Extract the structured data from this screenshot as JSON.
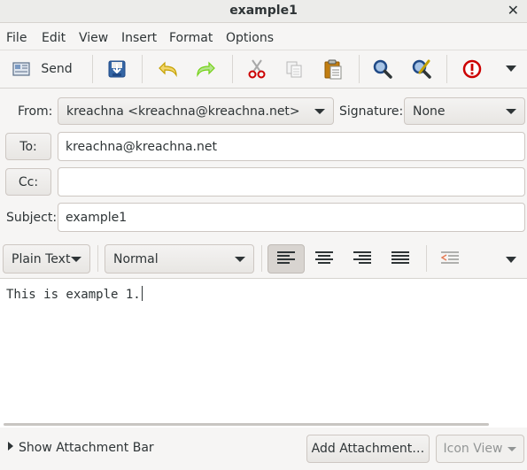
{
  "window": {
    "title": "example1"
  },
  "menubar": {
    "items": [
      "File",
      "Edit",
      "View",
      "Insert",
      "Format",
      "Options"
    ]
  },
  "toolbar": {
    "send_label": "Send",
    "icons": [
      "send-icon",
      "save-draft-icon",
      "undo-icon",
      "redo-icon",
      "cut-icon",
      "copy-icon",
      "paste-icon",
      "find-icon",
      "spell-check-icon",
      "priority-icon",
      "overflow-arrow-icon"
    ]
  },
  "headers": {
    "from_label": "From:",
    "from_value": "kreachna <kreachna@kreachna.net>",
    "signature_label": "Signature:",
    "signature_value": "None",
    "to_button": "To:",
    "to_value": "kreachna@kreachna.net",
    "cc_button": "Cc:",
    "cc_value": "",
    "subject_label": "Subject:",
    "subject_value": "example1"
  },
  "format_bar": {
    "mode": "Plain Text",
    "paragraph_style": "Normal",
    "alignment": "left",
    "alignment_options": [
      "left",
      "center",
      "right",
      "justify"
    ]
  },
  "editor": {
    "body": "This is example 1."
  },
  "bottom": {
    "expander_label": "Show Attachment Bar",
    "add_attachment": "Add Attachment…",
    "view_mode": "Icon View"
  },
  "colors": {
    "window_bg": "#f6f5f4",
    "priority": "#cc0000",
    "undo": "#c4a000",
    "redo": "#73d216"
  }
}
